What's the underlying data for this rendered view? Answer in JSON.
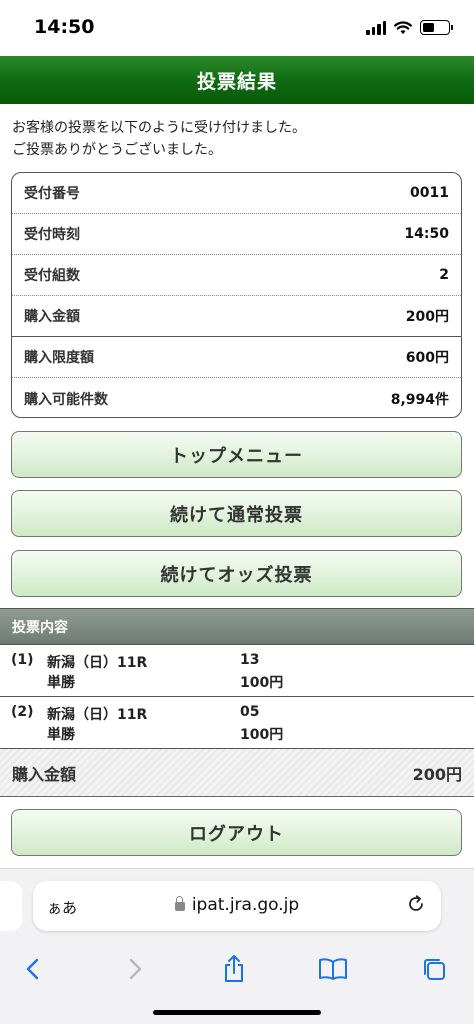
{
  "status_bar": {
    "time": "14:50"
  },
  "header": {
    "title": "投票結果"
  },
  "intro": {
    "line1": "お客様の投票を以下のように受け付けました。",
    "line2": "ご投票ありがとうございました。"
  },
  "receipt": [
    {
      "label": "受付番号",
      "value": "0011"
    },
    {
      "label": "受付時刻",
      "value": "14:50"
    },
    {
      "label": "受付組数",
      "value": "2"
    },
    {
      "label": "購入金額",
      "value": "200円"
    },
    {
      "label": "購入限度額",
      "value": "600円"
    },
    {
      "label": "購入可能件数",
      "value": "8,994件"
    }
  ],
  "buttons": {
    "top_menu": "トップメニュー",
    "continue_normal": "続けて通常投票",
    "continue_odds": "続けてオッズ投票",
    "logout": "ログアウト"
  },
  "bets_section": {
    "title": "投票内容",
    "items": [
      {
        "index": "(1)",
        "race": "新潟（日）11R",
        "horse": "13",
        "type": "単勝",
        "amount": "100円"
      },
      {
        "index": "(2)",
        "race": "新潟（日）11R",
        "horse": "05",
        "type": "単勝",
        "amount": "100円"
      }
    ]
  },
  "total": {
    "label": "購入金額",
    "value": "200円"
  },
  "browser": {
    "aa_label": "ぁあ",
    "url": "ipat.jra.go.jp"
  },
  "colors": {
    "header_green": "#0f6b12",
    "button_green": "#e3f3de",
    "section_gray": "#7f8b83",
    "ios_blue": "#1a73e8"
  }
}
